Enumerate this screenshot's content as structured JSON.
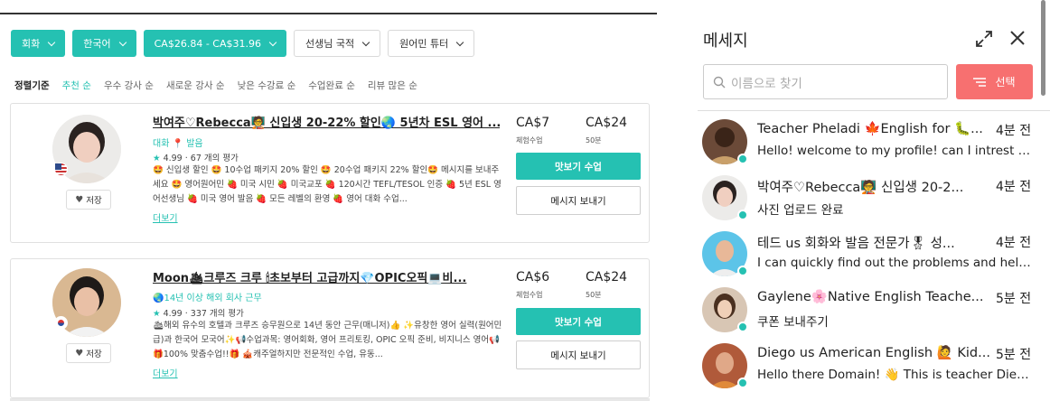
{
  "filters": [
    {
      "label": "회화",
      "style": "teal"
    },
    {
      "label": "한국어",
      "style": "teal"
    },
    {
      "label": "CA$26.84 - CA$31.96",
      "style": "teal"
    },
    {
      "label": "선생님 국적",
      "style": "white"
    },
    {
      "label": "원어민 튜터",
      "style": "white"
    }
  ],
  "sort": {
    "label": "정렬기준",
    "options": [
      "추천 순",
      "우수 강사 순",
      "새로운 강사 순",
      "낮은 수강료 순",
      "수업완료 순",
      "리뷰 많은 순"
    ]
  },
  "tutors": [
    {
      "name": "박여주♡Rebecca🧑‍🏫 신입생 20-22% 할인🌏 5년차 ESL 영어 ...",
      "tags": "대화 📍 발음",
      "rating": "4.99",
      "reviews": "67 개의 평가",
      "description": "🤩 신입생 할인 🤩 10수업 패키지 20% 할인 🤩 20수업 패키지 22% 할인🤩 메시지를 보내주세요 🤩 영어원어민 🍓 미국 시민 🍓 미국교포 🍓 120시간 TEFL/TESOL 인증 🍓 5년 ESL 영어선생님 🍓 미국 영어 발음 🍓 모든 레벨의 환영 🍓 영어 대화 수업...",
      "more": "더보기",
      "price1": "CA$7",
      "price1_label": "체험수업",
      "price2": "CA$24",
      "price2_label": "50분",
      "book": "맛보기 수업",
      "message": "메시지 보내기",
      "save": "저장",
      "flag": "us"
    },
    {
      "name": "Moon🛳크루즈 크루 🕯초보부터 고급까지💎OPIC오픽💻비...",
      "tags": "🌏14년 이상 해외 회사 근무",
      "rating": "4.99",
      "reviews": "337 개의 평가",
      "description": "🛳해외 유수의 호텔과 크루즈 승무원으로 14년 동안 근무(매니저)👍 ✨유창한 영어 실력(원어민급)과 한국어 모국어✨📢수업과목: 영어회화, 영어 프리토킹, OPIC 오픽 준비, 비지니스 영어📢 🎁100% 맞춤수업!!🎁 🎪캐주얼하지만 전문적인 수업, 유동...",
      "more": "더보기",
      "price1": "CA$6",
      "price1_label": "체험수업",
      "price2": "CA$24",
      "price2_label": "50분",
      "book": "맛보기 수업",
      "message": "메시지 보내기",
      "save": "저장",
      "flag": "kr"
    }
  ],
  "panel": {
    "title": "메세지",
    "search_placeholder": "이름으로 찾기",
    "select_label": "선택",
    "messages": [
      {
        "name": "Teacher Pheladi 🍁English for 🐛...",
        "time": "4분 전",
        "text": "Hello! welcome to my profile! can I intrest you ...",
        "avatar_color": "#5a3a2a"
      },
      {
        "name": "박여주♡Rebecca🧑‍🏫 신입생 20-2...",
        "time": "4분 전",
        "text": "사진 업로드 완료",
        "avatar_color": "#d8c8c0"
      },
      {
        "name": "테드 us 회화와 발음 전문가🎖 성...",
        "time": "4분 전",
        "text": "I can quickly find out the problems and help y...",
        "avatar_color": "#5cc4e8"
      },
      {
        "name": "Gaylene🌸Native English Teache...",
        "time": "5분 전",
        "text": "쿠폰 보내주기",
        "avatar_color": "#c9a48a"
      },
      {
        "name": "Diego us American English 🙋 Kid...",
        "time": "5분 전",
        "text": "Hello there Domain! 👋 This is teacher Diego....",
        "avatar_color": "#b05a3a"
      }
    ]
  },
  "colors": {
    "accent": "#25c1b2",
    "select_button": "#f77070"
  }
}
